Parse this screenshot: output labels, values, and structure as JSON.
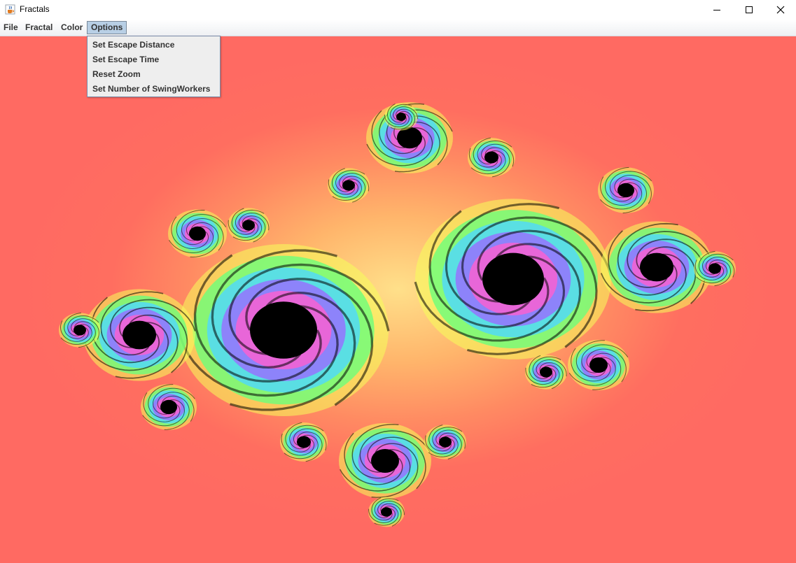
{
  "window": {
    "title": "Fractals",
    "app_icon": "java-cup-icon",
    "controls": {
      "minimize": "minimize-icon",
      "maximize": "maximize-icon",
      "close": "close-icon"
    }
  },
  "menubar": {
    "items": [
      {
        "label": "File"
      },
      {
        "label": "Fractal"
      },
      {
        "label": "Color"
      },
      {
        "label": "Options",
        "active": true
      }
    ]
  },
  "options_menu": {
    "items": [
      {
        "label": "Set Escape Distance"
      },
      {
        "label": "Set Escape Time"
      },
      {
        "label": "Reset Zoom"
      },
      {
        "label": "Set Number of SwingWorkers"
      }
    ]
  },
  "canvas": {
    "background_color": "#ff6a62",
    "fractal_colors": [
      "#000000",
      "#ff5fd0",
      "#9a6bff",
      "#4fd8ff",
      "#6bff7a",
      "#f5ff5a"
    ]
  }
}
